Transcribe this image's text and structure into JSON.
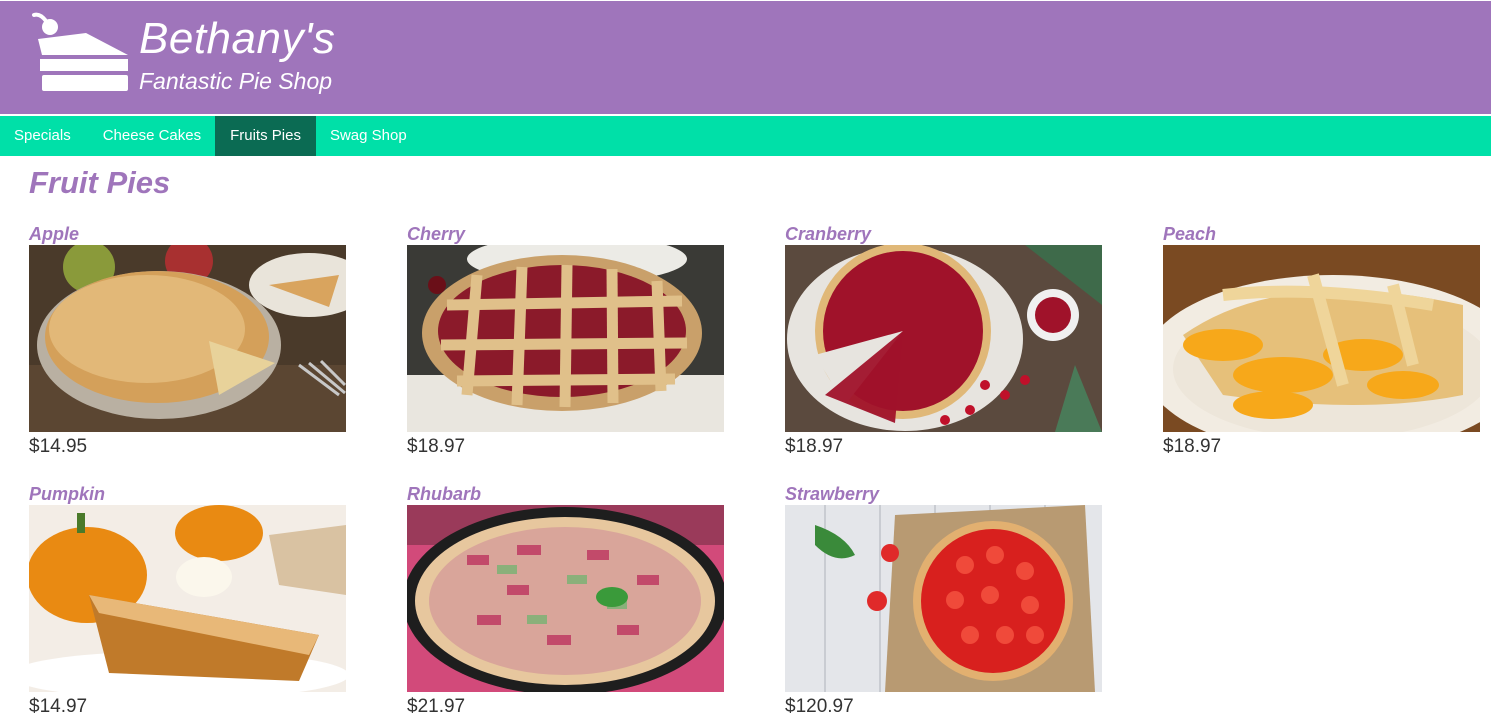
{
  "brand": {
    "name": "Bethany's",
    "tagline": "Fantastic Pie Shop",
    "logo_icon": "pie-slice-cherry-icon",
    "color": "#9f75bb"
  },
  "nav": {
    "color": "#00e0a8",
    "active_color": "#0b6b53",
    "items": [
      {
        "label": "Specials"
      },
      {
        "label": "Cheese Cakes"
      },
      {
        "label": "Fruits Pies",
        "active": true
      },
      {
        "label": "Swag Shop"
      }
    ]
  },
  "page": {
    "title": "Fruit Pies"
  },
  "products": [
    {
      "name": "Apple",
      "price": "$14.95",
      "image": "apple-pie-photo"
    },
    {
      "name": "Cherry",
      "price": "$18.97",
      "image": "cherry-pie-photo"
    },
    {
      "name": "Cranberry",
      "price": "$18.97",
      "image": "cranberry-pie-photo"
    },
    {
      "name": "Peach",
      "price": "$18.97",
      "image": "peach-pie-photo"
    },
    {
      "name": "Pumpkin",
      "price": "$14.97",
      "image": "pumpkin-pie-photo"
    },
    {
      "name": "Rhubarb",
      "price": "$21.97",
      "image": "rhubarb-pie-photo"
    },
    {
      "name": "Strawberry",
      "price": "$120.97",
      "image": "strawberry-pie-photo"
    }
  ]
}
